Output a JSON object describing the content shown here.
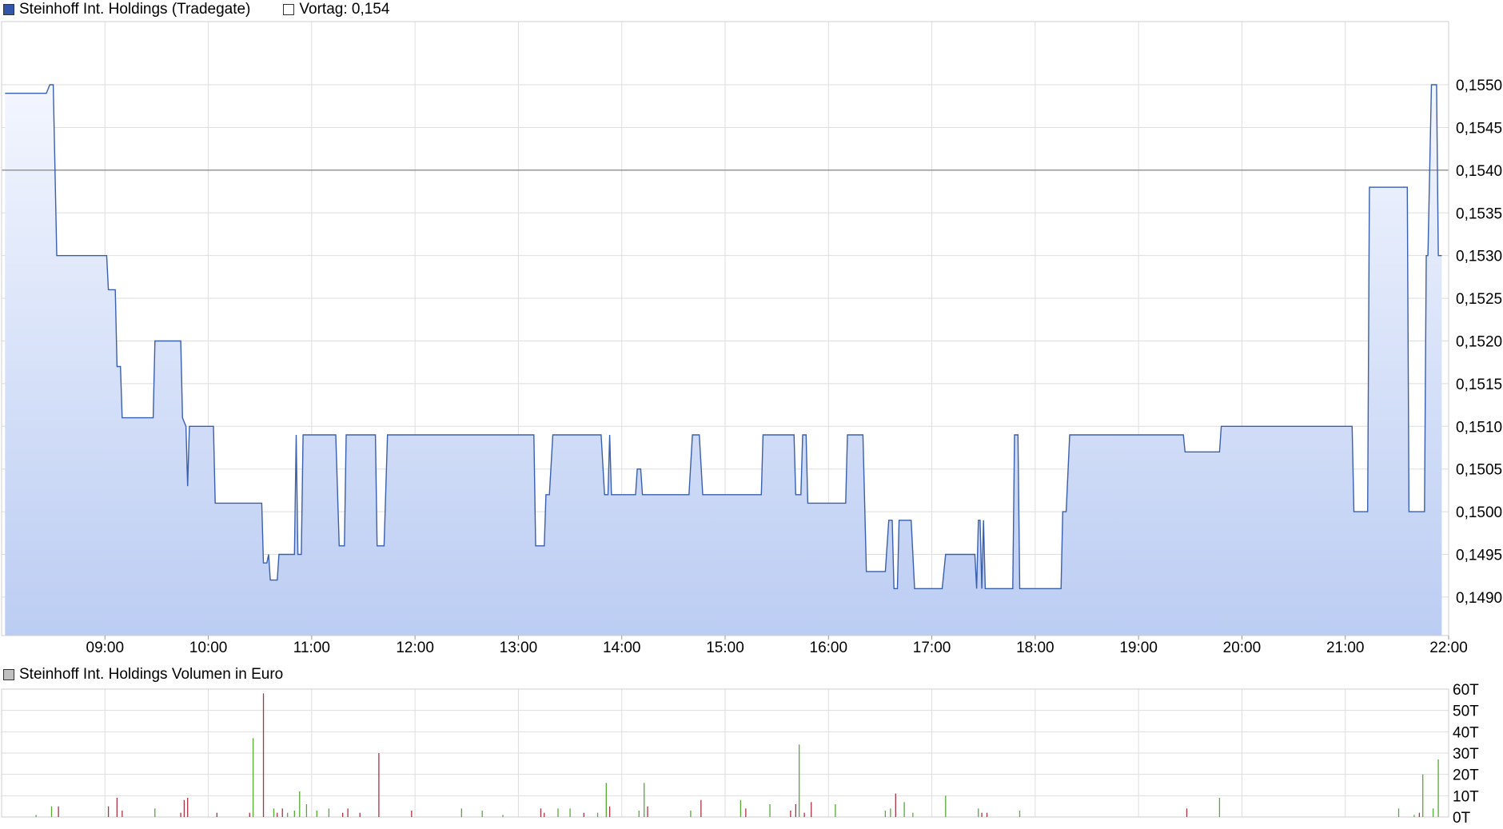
{
  "legend": {
    "series_label": "Steinhoff Int. Holdings (Tradegate)",
    "prev_label": "Vortag: 0,154",
    "volume_label": "Steinhoff Int. Holdings Volumen in Euro"
  },
  "colors": {
    "line": "#3a5fad",
    "fill_top": "#f3f6fe",
    "fill_bottom": "#bccdf3",
    "grid": "#dedede",
    "swatch_series": "#3355aa",
    "swatch_prev": "#ffffff",
    "swatch_volume": "#c0c0c0",
    "vol_up": "#55aa33",
    "vol_down": "#aa3344"
  },
  "chart_data": [
    {
      "type": "area",
      "name": "Steinhoff Int. Holdings (Tradegate)",
      "x_ticks": [
        "09:00",
        "10:00",
        "11:00",
        "12:00",
        "13:00",
        "14:00",
        "15:00",
        "16:00",
        "17:00",
        "18:00",
        "19:00",
        "20:00",
        "21:00",
        "22:00"
      ],
      "y_ticks": [
        "0,1550",
        "0,1545",
        "0,1540",
        "0,1535",
        "0,1530",
        "0,1525",
        "0,1520",
        "0,1515",
        "0,1510",
        "0,1505",
        "0,1500",
        "0,1495",
        "0,1490"
      ],
      "ylim": [
        0.14855,
        0.15574
      ],
      "xlim": [
        "08:00",
        "22:00"
      ],
      "reference_line": 0.154,
      "series": [
        {
          "values": [
            [
              "08:02",
              0.1549
            ],
            [
              "08:26",
              0.1549
            ],
            [
              "08:28",
              0.155
            ],
            [
              "08:30",
              0.155
            ],
            [
              "08:32",
              0.153
            ],
            [
              "09:01",
              0.153
            ],
            [
              "09:02",
              0.1526
            ],
            [
              "09:06",
              0.1526
            ],
            [
              "09:07",
              0.1517
            ],
            [
              "09:09",
              0.1517
            ],
            [
              "09:10",
              0.1511
            ],
            [
              "09:28",
              0.1511
            ],
            [
              "09:29",
              0.152
            ],
            [
              "09:44",
              0.152
            ],
            [
              "09:45",
              0.1511
            ],
            [
              "09:47",
              0.151
            ],
            [
              "09:48",
              0.1503
            ],
            [
              "09:49",
              0.151
            ],
            [
              "10:03",
              0.151
            ],
            [
              "10:04",
              0.1501
            ],
            [
              "10:31",
              0.1501
            ],
            [
              "10:32",
              0.1494
            ],
            [
              "10:34",
              0.1494
            ],
            [
              "10:35",
              0.1495
            ],
            [
              "10:36",
              0.1492
            ],
            [
              "10:40",
              0.1492
            ],
            [
              "10:41",
              0.1495
            ],
            [
              "10:50",
              0.1495
            ],
            [
              "10:51",
              0.1509
            ],
            [
              "10:52",
              0.1495
            ],
            [
              "10:54",
              0.1495
            ],
            [
              "10:55",
              0.1509
            ],
            [
              "11:14",
              0.1509
            ],
            [
              "11:16",
              0.1496
            ],
            [
              "11:19",
              0.1496
            ],
            [
              "11:20",
              0.1509
            ],
            [
              "11:37",
              0.1509
            ],
            [
              "11:38",
              0.1496
            ],
            [
              "11:42",
              0.1496
            ],
            [
              "11:44",
              0.1509
            ],
            [
              "13:09",
              0.1509
            ],
            [
              "13:10",
              0.1496
            ],
            [
              "13:15",
              0.1496
            ],
            [
              "13:16",
              0.1502
            ],
            [
              "13:18",
              0.1502
            ],
            [
              "13:20",
              0.1509
            ],
            [
              "13:48",
              0.1509
            ],
            [
              "13:50",
              0.1502
            ],
            [
              "13:52",
              0.1502
            ],
            [
              "13:53",
              0.1509
            ],
            [
              "13:54",
              0.1502
            ],
            [
              "14:08",
              0.1502
            ],
            [
              "14:09",
              0.1505
            ],
            [
              "14:11",
              0.1505
            ],
            [
              "14:12",
              0.1502
            ],
            [
              "14:39",
              0.1502
            ],
            [
              "14:41",
              0.1509
            ],
            [
              "14:45",
              0.1509
            ],
            [
              "14:47",
              0.1502
            ],
            [
              "15:21",
              0.1502
            ],
            [
              "15:22",
              0.1509
            ],
            [
              "15:40",
              0.1509
            ],
            [
              "15:41",
              0.1502
            ],
            [
              "15:44",
              0.1502
            ],
            [
              "15:45",
              0.1509
            ],
            [
              "15:47",
              0.1509
            ],
            [
              "15:48",
              0.1501
            ],
            [
              "16:10",
              0.1501
            ],
            [
              "16:11",
              0.1509
            ],
            [
              "16:20",
              0.1509
            ],
            [
              "16:22",
              0.1493
            ],
            [
              "16:33",
              0.1493
            ],
            [
              "16:35",
              0.1499
            ],
            [
              "16:37",
              0.1499
            ],
            [
              "16:38",
              0.1491
            ],
            [
              "16:40",
              0.1491
            ],
            [
              "16:41",
              0.1499
            ],
            [
              "16:48",
              0.1499
            ],
            [
              "16:50",
              0.1491
            ],
            [
              "17:06",
              0.1491
            ],
            [
              "17:08",
              0.1495
            ],
            [
              "17:25",
              0.1495
            ],
            [
              "17:26",
              0.1491
            ],
            [
              "17:27",
              0.1499
            ],
            [
              "17:28",
              0.1499
            ],
            [
              "17:29",
              0.1491
            ],
            [
              "17:30",
              0.1499
            ],
            [
              "17:31",
              0.1491
            ],
            [
              "17:47",
              0.1491
            ],
            [
              "17:48",
              0.1509
            ],
            [
              "17:50",
              0.1509
            ],
            [
              "17:51",
              0.1491
            ],
            [
              "18:15",
              0.1491
            ],
            [
              "18:16",
              0.15
            ],
            [
              "18:18",
              0.15
            ],
            [
              "18:20",
              0.1509
            ],
            [
              "19:26",
              0.1509
            ],
            [
              "19:27",
              0.1507
            ],
            [
              "19:47",
              0.1507
            ],
            [
              "19:48",
              0.151
            ],
            [
              "21:04",
              0.151
            ],
            [
              "21:05",
              0.15
            ],
            [
              "21:13",
              0.15
            ],
            [
              "21:14",
              0.1538
            ],
            [
              "21:36",
              0.1538
            ],
            [
              "21:37",
              0.15
            ],
            [
              "21:46",
              0.15
            ],
            [
              "21:47",
              0.153
            ],
            [
              "21:48",
              0.153
            ],
            [
              "21:50",
              0.155
            ],
            [
              "21:53",
              0.155
            ],
            [
              "21:54",
              0.153
            ],
            [
              "21:56",
              0.153
            ]
          ]
        }
      ]
    },
    {
      "type": "bar",
      "name": "Steinhoff Int. Holdings Volumen in Euro",
      "y_ticks": [
        "60T",
        "50T",
        "40T",
        "30T",
        "20T",
        "10T",
        "0T"
      ],
      "ylim": [
        0,
        60
      ],
      "xlim": [
        "08:00",
        "22:00"
      ],
      "units": "T EUR",
      "bars": [
        [
          "08:20",
          1,
          "u"
        ],
        [
          "08:29",
          5,
          "u"
        ],
        [
          "08:33",
          5,
          "d"
        ],
        [
          "09:02",
          5,
          "d"
        ],
        [
          "09:07",
          9,
          "d"
        ],
        [
          "09:10",
          3,
          "d"
        ],
        [
          "09:29",
          4,
          "u"
        ],
        [
          "09:44",
          2,
          "d"
        ],
        [
          "09:46",
          8,
          "d"
        ],
        [
          "09:48",
          9,
          "d"
        ],
        [
          "10:05",
          2,
          "d"
        ],
        [
          "10:24",
          2,
          "d"
        ],
        [
          "10:26",
          37,
          "u"
        ],
        [
          "10:32",
          58,
          "d"
        ],
        [
          "10:38",
          4,
          "u"
        ],
        [
          "10:40",
          2,
          "d"
        ],
        [
          "10:43",
          4,
          "d"
        ],
        [
          "10:46",
          2,
          "u"
        ],
        [
          "10:50",
          3,
          "u"
        ],
        [
          "10:53",
          12,
          "u"
        ],
        [
          "10:57",
          6,
          "u"
        ],
        [
          "11:03",
          3,
          "u"
        ],
        [
          "11:10",
          4,
          "u"
        ],
        [
          "11:18",
          2,
          "d"
        ],
        [
          "11:21",
          4,
          "d"
        ],
        [
          "11:28",
          2,
          "d"
        ],
        [
          "11:39",
          30,
          "d"
        ],
        [
          "11:58",
          3,
          "d"
        ],
        [
          "12:27",
          4,
          "u"
        ],
        [
          "12:39",
          3,
          "u"
        ],
        [
          "12:51",
          1,
          "u"
        ],
        [
          "13:13",
          4,
          "d"
        ],
        [
          "13:15",
          2,
          "d"
        ],
        [
          "13:23",
          4,
          "u"
        ],
        [
          "13:30",
          4,
          "u"
        ],
        [
          "13:38",
          2,
          "d"
        ],
        [
          "13:46",
          2,
          "u"
        ],
        [
          "13:51",
          16,
          "u"
        ],
        [
          "13:53",
          5,
          "d"
        ],
        [
          "14:10",
          3,
          "u"
        ],
        [
          "14:13",
          16,
          "u"
        ],
        [
          "14:15",
          5,
          "d"
        ],
        [
          "14:40",
          3,
          "u"
        ],
        [
          "14:46",
          8,
          "d"
        ],
        [
          "15:09",
          8,
          "u"
        ],
        [
          "15:12",
          4,
          "d"
        ],
        [
          "15:26",
          6,
          "u"
        ],
        [
          "15:38",
          3,
          "d"
        ],
        [
          "15:41",
          6,
          "d"
        ],
        [
          "15:43",
          34,
          "u"
        ],
        [
          "15:46",
          2,
          "d"
        ],
        [
          "15:50",
          7,
          "d"
        ],
        [
          "16:04",
          6,
          "u"
        ],
        [
          "16:33",
          3,
          "u"
        ],
        [
          "16:36",
          4,
          "u"
        ],
        [
          "16:39",
          11,
          "d"
        ],
        [
          "16:44",
          7,
          "u"
        ],
        [
          "16:49",
          2,
          "u"
        ],
        [
          "17:08",
          10,
          "u"
        ],
        [
          "17:27",
          4,
          "u"
        ],
        [
          "17:29",
          2,
          "d"
        ],
        [
          "17:32",
          2,
          "d"
        ],
        [
          "17:51",
          3,
          "u"
        ],
        [
          "19:28",
          4,
          "d"
        ],
        [
          "19:47",
          9,
          "u"
        ],
        [
          "21:31",
          4,
          "u"
        ],
        [
          "21:40",
          1,
          "u"
        ],
        [
          "21:43",
          2,
          "d"
        ],
        [
          "21:45",
          20,
          "u"
        ],
        [
          "21:51",
          4,
          "u"
        ],
        [
          "21:54",
          27,
          "u"
        ]
      ]
    }
  ]
}
